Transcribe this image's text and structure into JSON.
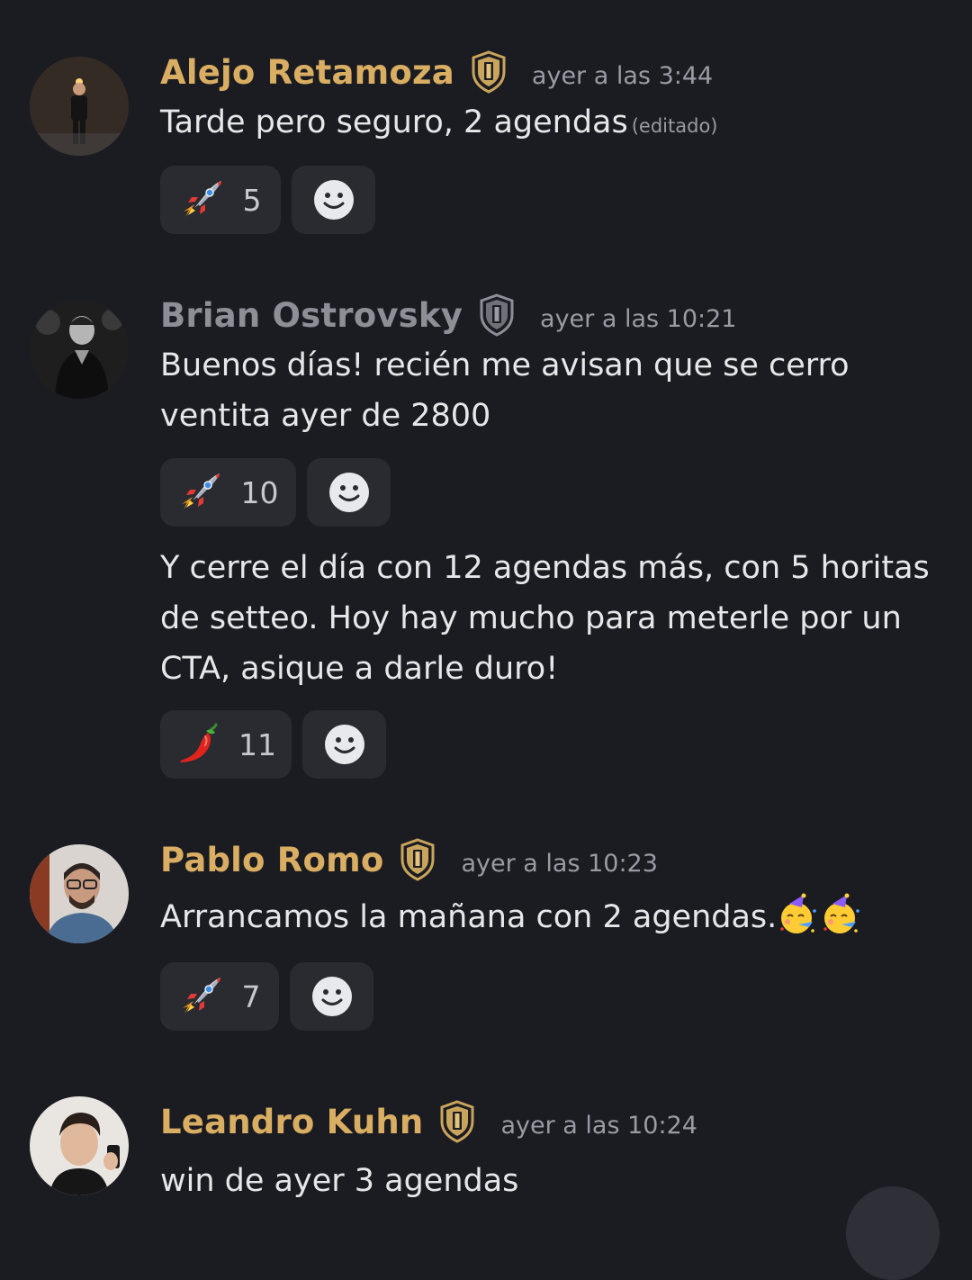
{
  "messages": [
    {
      "author": "Alejo Retamoza",
      "author_color": "#d9ae63",
      "timestamp": "ayer a las 3:44",
      "text": "Tarde pero seguro, 2 agendas",
      "edited_label": "(editado)",
      "reactions": [
        {
          "emoji": "rocket-icon",
          "count": "5"
        }
      ]
    },
    {
      "author": "Brian Ostrovsky",
      "author_color": "#8d8e96",
      "timestamp": "ayer a las 10:21",
      "text": "Buenos días! recién me avisan que se cerro ventita ayer de 2800",
      "reactions": [
        {
          "emoji": "rocket-icon",
          "count": "10"
        }
      ],
      "followup": {
        "text": "Y cerre el día con 12 agendas más, con 5 horitas de setteo. Hoy hay mucho para meterle por un CTA, asique a darle duro!",
        "reactions": [
          {
            "emoji": "chili-pepper-icon",
            "count": "11"
          }
        ]
      }
    },
    {
      "author": "Pablo Romo",
      "author_color": "#d9ae63",
      "timestamp": "ayer a las 10:23",
      "text": "Arrancamos la mañana con 2 agendas.",
      "inline_emojis": [
        "partying-face-icon",
        "partying-face-icon"
      ],
      "reactions": [
        {
          "emoji": "rocket-icon",
          "count": "7"
        }
      ]
    },
    {
      "author": "Leandro Kuhn",
      "author_color": "#d9ae63",
      "timestamp": "ayer a las 10:24",
      "text": "win de ayer 3 agendas"
    }
  ],
  "colors": {
    "background": "#1b1c21",
    "reaction_bg": "#2a2b31",
    "gold_badge": "#c9a45c",
    "timestamp": "#9a9ba3"
  }
}
